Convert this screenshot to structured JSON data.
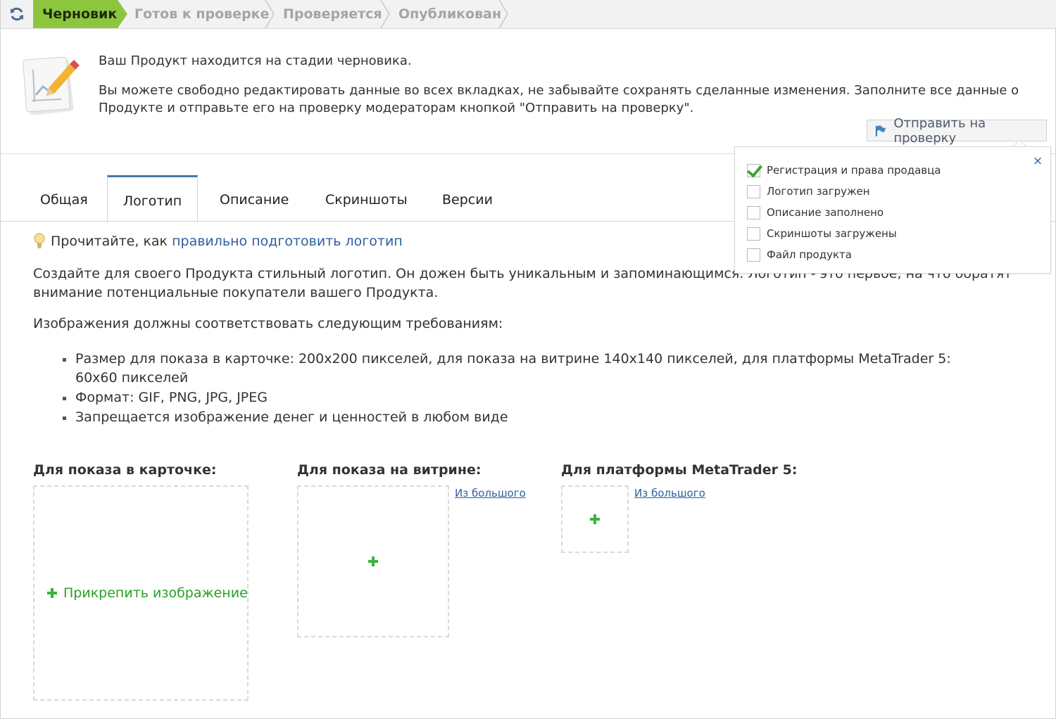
{
  "status": {
    "steps": [
      {
        "label": "Черновик",
        "active": true
      },
      {
        "label": "Готов к проверке",
        "active": false
      },
      {
        "label": "Проверяется",
        "active": false
      },
      {
        "label": "Опубликован",
        "active": false
      }
    ]
  },
  "info": {
    "line1": "Ваш Продукт находится на стадии черновика.",
    "line2": "Вы можете свободно редактировать данные во всех вкладках, не забывайте сохранять сделанные изменения. Заполните все данные о Продукте и отправьте его на проверку модераторам кнопкой \"Отправить на проверку\".",
    "send_label": "Отправить на проверку"
  },
  "checklist": {
    "close": "×",
    "items": [
      {
        "label": "Регистрация и права продавца",
        "checked": true
      },
      {
        "label": "Логотип загружен",
        "checked": false
      },
      {
        "label": "Описание заполнено",
        "checked": false
      },
      {
        "label": "Скриншоты загружены",
        "checked": false
      },
      {
        "label": "Файл продукта",
        "checked": false
      }
    ]
  },
  "tabs": [
    {
      "label": "Общая",
      "active": false
    },
    {
      "label": "Логотип",
      "active": true
    },
    {
      "label": "Описание",
      "active": false
    },
    {
      "label": "Скриншоты",
      "active": false
    },
    {
      "label": "Версии",
      "active": false
    }
  ],
  "content": {
    "tip_prefix": "Прочитайте, как",
    "tip_link": "правильно подготовить логотип",
    "para1": "Создайте для своего Продукта стильный логотип. Он дожен быть уникальным и запоминающимся. Логотип - это первое, на что обратят внимание потенциальные покупатели вашего Продукта.",
    "para2": "Изображения должны соответствовать следующим требованиям:",
    "requirements": [
      "Размер для показа в карточке: 200x200 пикселей, для показа на витрине 140x140 пикселей, для платформы MetaTrader 5: 60x60 пикселей",
      "Формат: GIF, PNG, JPG, JPEG",
      "Запрещается изображение денег и ценностей в любом виде"
    ]
  },
  "logos": {
    "card_label": "Для показа в карточке:",
    "attach_label": "Прикрепить изображение",
    "showcase_label": "Для показа на витрине:",
    "showcase_from_big": "Из большого",
    "mt5_label": "Для платформы MetaTrader 5:",
    "mt5_from_big": "Из большого"
  },
  "icons": {
    "refresh": "refresh-icon",
    "document": "document-pencil-icon",
    "send": "flag-icon",
    "tip": "lightbulb-icon",
    "add": "plus-icon"
  },
  "colors": {
    "active_step": "#8cc63e",
    "link": "#2e5f9e",
    "attach_green": "#27a027",
    "tab_accent": "#4a76a8"
  }
}
